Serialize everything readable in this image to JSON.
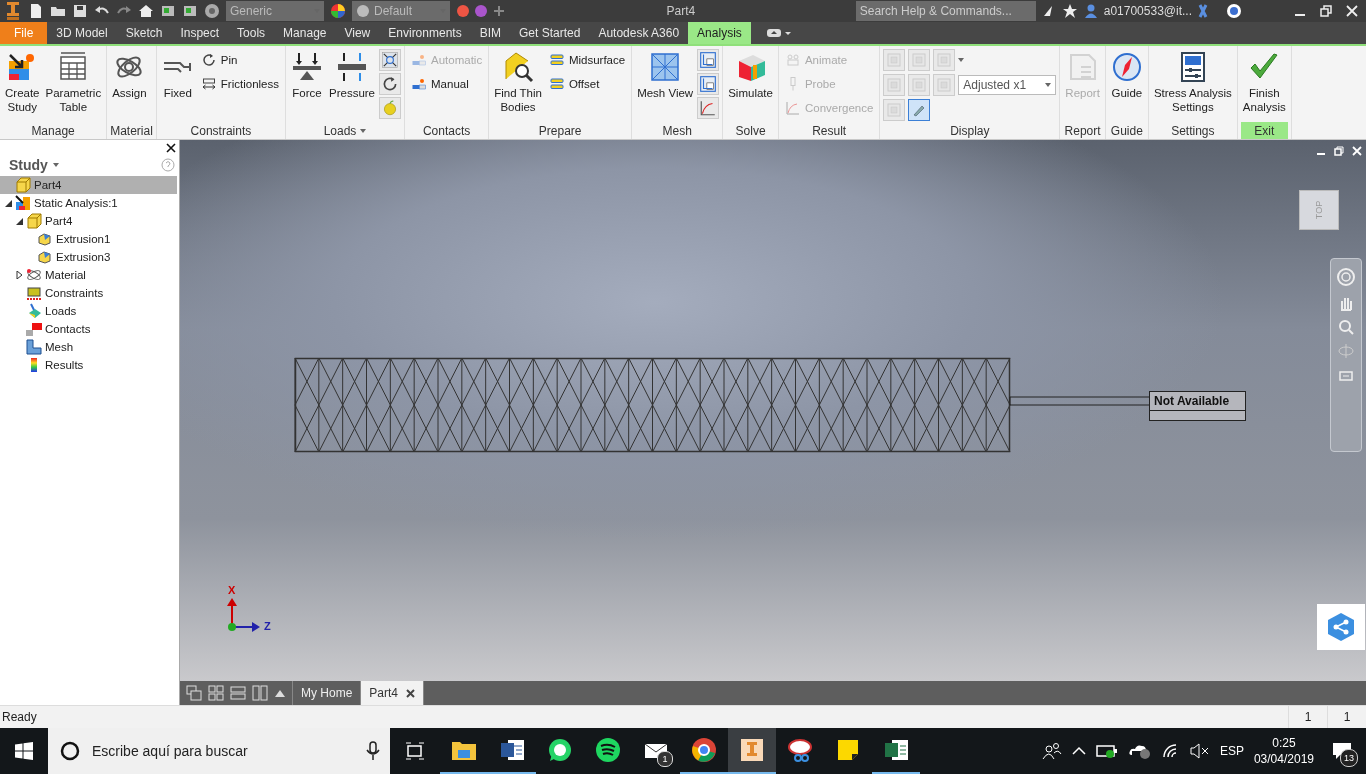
{
  "title_bar": {
    "material": "Generic",
    "appearance": "Default",
    "title": "Part4",
    "search_placeholder": "Search Help & Commands...",
    "user": "a01700533@it..."
  },
  "menu_tabs": [
    {
      "label": "File",
      "kind": "file",
      "selected": false
    },
    {
      "label": "3D Model",
      "kind": "tab",
      "selected": false
    },
    {
      "label": "Sketch",
      "kind": "tab",
      "selected": false
    },
    {
      "label": "Inspect",
      "kind": "tab",
      "selected": false
    },
    {
      "label": "Tools",
      "kind": "tab",
      "selected": false
    },
    {
      "label": "Manage",
      "kind": "tab",
      "selected": false
    },
    {
      "label": "View",
      "kind": "tab",
      "selected": false
    },
    {
      "label": "Environments",
      "kind": "tab",
      "selected": false
    },
    {
      "label": "BIM",
      "kind": "tab",
      "selected": false
    },
    {
      "label": "Get Started",
      "kind": "tab",
      "selected": false
    },
    {
      "label": "Autodesk A360",
      "kind": "tab",
      "selected": false
    },
    {
      "label": "Analysis",
      "kind": "tab",
      "selected": true
    }
  ],
  "ribbon": [
    {
      "label": "Manage",
      "items": [
        {
          "kind": "large",
          "label": "Create\nStudy",
          "disabled": false
        },
        {
          "kind": "large",
          "label": "Parametric\nTable",
          "disabled": false
        }
      ]
    },
    {
      "label": "Material",
      "items": [
        {
          "kind": "large",
          "label": "Assign",
          "disabled": false
        }
      ]
    },
    {
      "label": "Constraints",
      "items": [
        {
          "kind": "large",
          "label": "Fixed",
          "disabled": false
        },
        {
          "kind": "small",
          "label": "Pin",
          "disabled": false
        },
        {
          "kind": "small",
          "label": "Frictionless",
          "disabled": false
        }
      ]
    },
    {
      "label": "Loads",
      "has_menu": true,
      "items": [
        {
          "kind": "large",
          "label": "Force",
          "disabled": false
        },
        {
          "kind": "large",
          "label": "Pressure",
          "disabled": false
        },
        {
          "kind": "icon",
          "disabled": false
        },
        {
          "kind": "icon",
          "disabled": false
        },
        {
          "kind": "icon",
          "disabled": false
        }
      ]
    },
    {
      "label": "Contacts",
      "items": [
        {
          "kind": "small",
          "label": "Automatic",
          "disabled": true
        },
        {
          "kind": "small",
          "label": "Manual",
          "disabled": false
        }
      ]
    },
    {
      "label": "Prepare",
      "items": [
        {
          "kind": "large",
          "label": "Find Thin\nBodies",
          "disabled": false
        },
        {
          "kind": "small",
          "label": "Midsurface",
          "disabled": false
        },
        {
          "kind": "small",
          "label": "Offset",
          "disabled": false
        }
      ]
    },
    {
      "label": "Mesh",
      "items": [
        {
          "kind": "large",
          "label": "Mesh View",
          "disabled": false
        },
        {
          "kind": "icon",
          "disabled": false
        },
        {
          "kind": "icon",
          "disabled": false
        },
        {
          "kind": "icon",
          "disabled": false
        }
      ]
    },
    {
      "label": "Solve",
      "items": [
        {
          "kind": "large",
          "label": "Simulate",
          "disabled": false
        }
      ]
    },
    {
      "label": "Result",
      "items": [
        {
          "kind": "small",
          "label": "Animate",
          "disabled": true
        },
        {
          "kind": "small",
          "label": "Probe",
          "disabled": true
        },
        {
          "kind": "small",
          "label": "Convergence",
          "disabled": true
        }
      ]
    },
    {
      "label": "Display",
      "kind": "grid",
      "rows": [
        [
          {
            "kind": "icon",
            "disabled": true,
            "selected": false
          },
          {
            "kind": "icon",
            "disabled": true,
            "selected": false
          },
          {
            "kind": "icon_menu",
            "disabled": true,
            "selected": false
          }
        ],
        [
          {
            "kind": "icon",
            "disabled": true,
            "selected": false
          },
          {
            "kind": "icon",
            "disabled": true,
            "selected": false
          },
          {
            "kind": "icon",
            "disabled": true,
            "selected": false
          },
          {
            "kind": "dropdown",
            "value": "Adjusted x1"
          }
        ],
        [
          {
            "kind": "icon",
            "disabled": true,
            "selected": false
          },
          {
            "kind": "icon",
            "disabled": false,
            "selected": true
          }
        ]
      ]
    },
    {
      "label": "Report",
      "items": [
        {
          "kind": "large",
          "label": "Report",
          "disabled": true
        }
      ]
    },
    {
      "label": "Guide",
      "items": [
        {
          "kind": "large",
          "label": "Guide",
          "disabled": false
        }
      ]
    },
    {
      "label": "Settings",
      "items": [
        {
          "kind": "large",
          "label": "Stress Analysis\nSettings",
          "disabled": false
        }
      ]
    },
    {
      "label": "Exit",
      "highlighted": true,
      "items": [
        {
          "kind": "large",
          "label": "Finish\nAnalysis",
          "disabled": false
        }
      ]
    }
  ],
  "browser": {
    "title": "Study",
    "tree": [
      {
        "label": "Part4",
        "kind": "part",
        "selected": true
      },
      {
        "label": "Static Analysis:1",
        "kind": "analysis",
        "selected": false,
        "expanded": true,
        "children": [
          {
            "label": "Part4",
            "kind": "part",
            "selected": false,
            "expanded": true,
            "children": [
              {
                "label": "Extrusion1",
                "kind": "feature",
                "selected": false
              },
              {
                "label": "Extrusion3",
                "kind": "feature",
                "selected": false
              }
            ]
          },
          {
            "label": "Material",
            "kind": "material",
            "selected": false,
            "expanded": false
          },
          {
            "label": "Constraints",
            "kind": "constraints",
            "selected": false
          },
          {
            "label": "Loads",
            "kind": "loads",
            "selected": false
          },
          {
            "label": "Contacts",
            "kind": "contacts",
            "selected": false
          },
          {
            "label": "Mesh",
            "kind": "mesh",
            "selected": false
          },
          {
            "label": "Results",
            "kind": "results",
            "selected": false
          }
        ]
      }
    ]
  },
  "viewport": {
    "view_cube": "TOP",
    "probe_label": "Not Available",
    "axis_labels": [
      "X",
      "Z"
    ]
  },
  "doc_tabs": [
    {
      "label": "My Home",
      "selected": false,
      "closable": false
    },
    {
      "label": "Part4",
      "selected": true,
      "closable": true
    }
  ],
  "status_bar": {
    "text": "Ready",
    "fields": [
      "1",
      "1"
    ]
  },
  "taskbar": {
    "search_placeholder": "Escribe aquí para buscar",
    "apps": [
      {
        "kind": "explorer",
        "running": true,
        "active": false
      },
      {
        "kind": "word",
        "running": true,
        "active": false
      },
      {
        "kind": "whatsapp",
        "running": false,
        "active": false
      },
      {
        "kind": "spotify",
        "running": false,
        "active": false
      },
      {
        "kind": "mail",
        "running": false,
        "active": false,
        "badge": "1"
      },
      {
        "kind": "chrome",
        "running": true,
        "active": false
      },
      {
        "kind": "inventor",
        "running": true,
        "active": true
      },
      {
        "kind": "snipping",
        "running": false,
        "active": false
      },
      {
        "kind": "sticky",
        "running": false,
        "active": false
      },
      {
        "kind": "excel",
        "running": true,
        "active": false
      }
    ],
    "language": "ESP",
    "time": "0:25",
    "date": "03/04/2019",
    "notifications": "13"
  }
}
